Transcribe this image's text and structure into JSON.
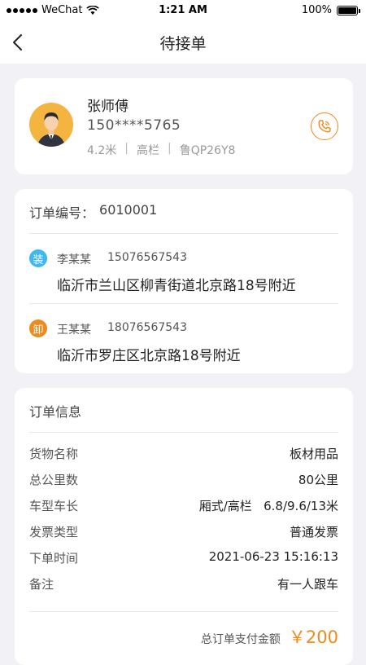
{
  "status_bar": {
    "carrier": "WeChat",
    "time": "1:21 AM",
    "battery": "100%",
    "battery_level": 1.0,
    "icons": [
      "signal-dots-icon",
      "wifi-icon",
      "battery-icon"
    ]
  },
  "nav": {
    "title": "待接单",
    "back_icon": "chevron-left-icon"
  },
  "driver": {
    "name": "张师傅",
    "phone": "150****5765",
    "truck_length": "4.2米",
    "sep1": "|",
    "truck_type": "高栏",
    "sep2": "|",
    "plate": "鲁QP26Y8",
    "call_icon": "phone-icon"
  },
  "order": {
    "number_label": "订单编号：",
    "number": "6010001",
    "load": {
      "badge": "装",
      "name": "李某某",
      "phone": "15076567543",
      "address": "临沂市兰山区柳青街道北京路18号附近"
    },
    "unload": {
      "badge": "卸",
      "name": "王某某",
      "phone": "18076567543",
      "address": "临沂市罗庄区北京路18号附近"
    }
  },
  "info": {
    "title": "订单信息",
    "rows": [
      {
        "label": "货物名称",
        "value": "板材用品"
      },
      {
        "label": "总公里数",
        "value": "80公里"
      },
      {
        "label": "车型车长",
        "value": "厢式/高栏   6.8/9.6/13米"
      },
      {
        "label": "发票类型",
        "value": "普通发票"
      },
      {
        "label": "下单时间",
        "value": "2021-06-23 15:16:13"
      },
      {
        "label": "备注",
        "value": "有一人跟车"
      }
    ],
    "total_label": "总订单支付金额",
    "total_amount": "￥200"
  },
  "colors": {
    "accent": "#f08a1c",
    "load_badge": "#3fb8f0",
    "avatar_bg": "#f4b540"
  }
}
